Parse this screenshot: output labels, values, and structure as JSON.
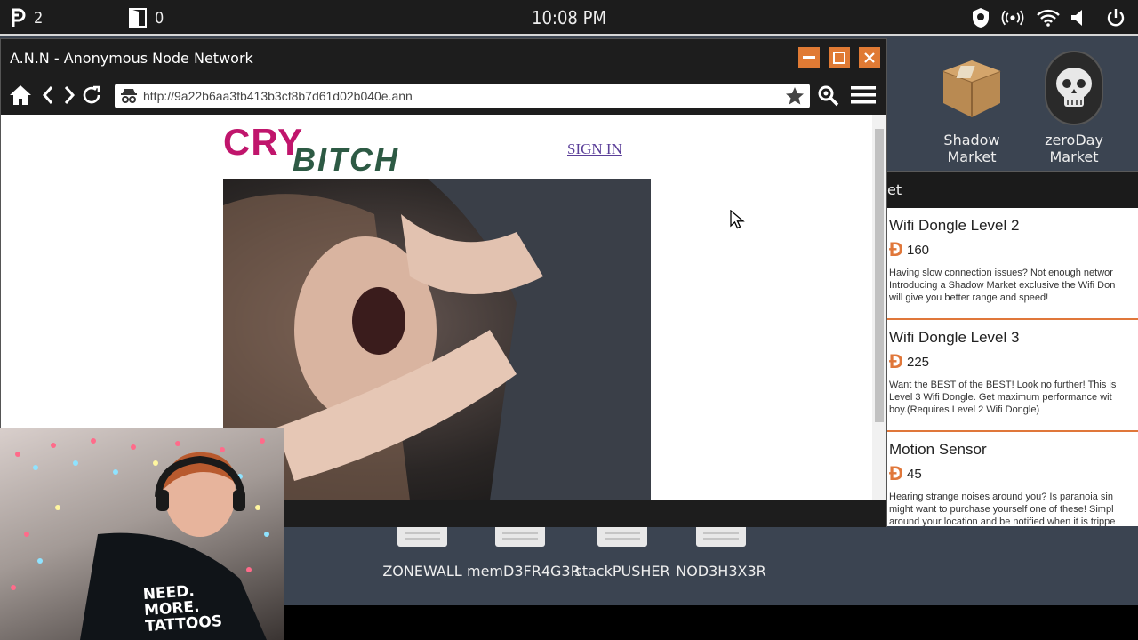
{
  "topbar": {
    "currency_count": "2",
    "door_count": "0",
    "clock": "10:08 PM"
  },
  "desktop": {
    "icons": [
      {
        "label": "Shadow Market",
        "icon": "package-box-icon"
      },
      {
        "label": "zeroDay Market",
        "icon": "skull-icon"
      }
    ]
  },
  "market": {
    "header_fragment": "et",
    "currency_symbol": "Ɖ",
    "products": [
      {
        "name": "Wifi Dongle Level 2",
        "price": "160",
        "desc": [
          "Having slow connection issues? Not enough networ",
          "Introducing a Shadow Market exclusive the Wifi Don",
          "will give you better range and speed!"
        ]
      },
      {
        "name": "Wifi Dongle Level 3",
        "price": "225",
        "desc": [
          "Want the BEST of the BEST! Look no further! This is",
          "Level 3 Wifi Dongle. Get maximum performance wit",
          "boy.(Requires Level 2 Wifi Dongle)"
        ]
      },
      {
        "name": "Motion Sensor",
        "price": "45",
        "desc": [
          "Hearing strange noises around you? Is paranoia sin",
          "might want to purchase yourself one of these! Simpl",
          "around your location and be notified when it is trippe"
        ]
      }
    ]
  },
  "browser": {
    "title": "A.N.N - Anonymous Node Network",
    "url": "http://9a22b6aa3fb413b3cf8b7d61d02b040e.ann",
    "page": {
      "logo_top": "CRY",
      "logo_bottom": "BITCH",
      "signin": "SIGN IN"
    }
  },
  "dock": {
    "items": [
      "ZONEWALL",
      "memD3FR4G3R",
      "stackPUSHER",
      "NOD3H3X3R"
    ]
  },
  "webcam": {
    "shirt_text": "NEED. MORE. TATTOOS"
  },
  "colors": {
    "accent": "#e07a34",
    "logo_pink": "#c0156c",
    "logo_green": "#2d5a44"
  }
}
